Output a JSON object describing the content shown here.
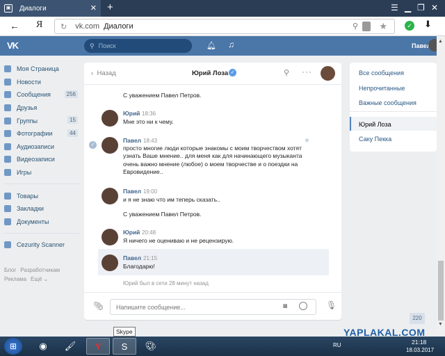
{
  "browser": {
    "tab_title": "Диалоги",
    "url_domain": "vk.com",
    "url_page": "Диалоги",
    "yandex_letter": "Я"
  },
  "vk": {
    "search_placeholder": "Поиск",
    "user_name": "Павел",
    "logo": "VK"
  },
  "left_nav": [
    {
      "label": "Моя Страница",
      "badge": ""
    },
    {
      "label": "Новости",
      "badge": ""
    },
    {
      "label": "Сообщения",
      "badge": "256"
    },
    {
      "label": "Друзья",
      "badge": ""
    },
    {
      "label": "Группы",
      "badge": "15"
    },
    {
      "label": "Фотографии",
      "badge": "44"
    },
    {
      "label": "Аудиозаписи",
      "badge": ""
    },
    {
      "label": "Видеозаписи",
      "badge": ""
    },
    {
      "label": "Игры",
      "badge": ""
    }
  ],
  "left_nav2": [
    {
      "label": "Товары"
    },
    {
      "label": "Закладки"
    },
    {
      "label": "Документы"
    }
  ],
  "left_nav3": [
    {
      "label": "Cezurity Scanner"
    }
  ],
  "footer": {
    "blog": "Блог",
    "devs": "Разработчикам",
    "ads": "Реклама",
    "more": "Ещё ⌄"
  },
  "chat": {
    "back": "Назад",
    "title": "Юрий Лоза",
    "messages": [
      {
        "name": "",
        "time": "",
        "text": "С уважением Павел Петров."
      },
      {
        "name": "Юрий",
        "time": "18:36",
        "text": "Мне это ни к чему."
      },
      {
        "name": "Павел",
        "time": "18:43",
        "text": "просто многие люди которые знакомы с моим творчеством хотят узнать Ваше мнение.. для меня как для начинающего музыканта очень важно мнение (любое) о моем творчестве и о поездки на Евровидение.."
      },
      {
        "name": "Павел",
        "time": "19:00",
        "text": "и я не знаю что им теперь сказать.."
      },
      {
        "name": "",
        "time": "",
        "text": "С уважением Павел Петров."
      },
      {
        "name": "Юрий",
        "time": "20:48",
        "text": "Я ничего не оцениваю и не рецензирую."
      },
      {
        "name": "Павел",
        "time": "21:15",
        "text": "Благодарю!"
      }
    ],
    "last_seen": "Юрий был в сети 28 минут назад",
    "input_placeholder": "Напишите сообщение..."
  },
  "right_nav": {
    "all": "Все сообщения",
    "unread": "Непрочитанные",
    "important": "Важные сообщения",
    "dialog1": "Юрий Лоза",
    "dialog2": "Саку Пекка"
  },
  "counter": "220",
  "tooltip": "Skype",
  "watermark": "YAPLAKAL.COM",
  "tray": {
    "lang": "RU",
    "time": "21:18",
    "date": "18.03.2017"
  }
}
